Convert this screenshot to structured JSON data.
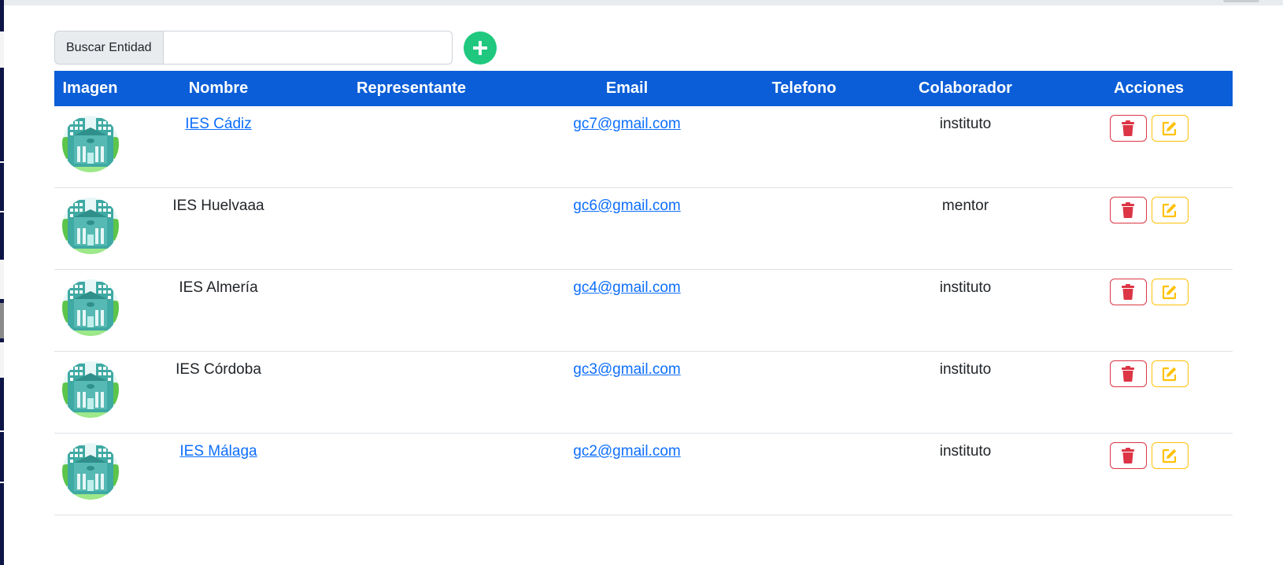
{
  "search": {
    "label": "Buscar Entidad",
    "value": "",
    "placeholder": ""
  },
  "add_button": {
    "icon": "plus-icon"
  },
  "table": {
    "headers": [
      "Imagen",
      "Nombre",
      "Representante",
      "Email",
      "Telefono",
      "Colaborador",
      "Acciones"
    ],
    "rows": [
      {
        "nombre": "IES Cádiz",
        "nombre_is_link": true,
        "representante": "",
        "email": "gc7@gmail.com",
        "telefono": "",
        "colaborador": "instituto"
      },
      {
        "nombre": "IES Huelvaaa",
        "nombre_is_link": false,
        "representante": "",
        "email": "gc6@gmail.com",
        "telefono": "",
        "colaborador": "mentor"
      },
      {
        "nombre": "IES Almería",
        "nombre_is_link": false,
        "representante": "",
        "email": "gc4@gmail.com",
        "telefono": "",
        "colaborador": "instituto"
      },
      {
        "nombre": "IES Córdoba",
        "nombre_is_link": false,
        "representante": "",
        "email": "gc3@gmail.com",
        "telefono": "",
        "colaborador": "instituto"
      },
      {
        "nombre": "IES Málaga",
        "nombre_is_link": true,
        "representante": "",
        "email": "gc2@gmail.com",
        "telefono": "",
        "colaborador": "instituto"
      }
    ]
  },
  "icons": {
    "avatar": "school-building-icon",
    "delete": "trash-icon",
    "edit": "edit-icon"
  },
  "colors": {
    "header_bg": "#0b5ed7",
    "add_button": "#1fc87e",
    "delete": "#dc3545",
    "edit": "#ffc107",
    "link": "#0d6efd"
  }
}
